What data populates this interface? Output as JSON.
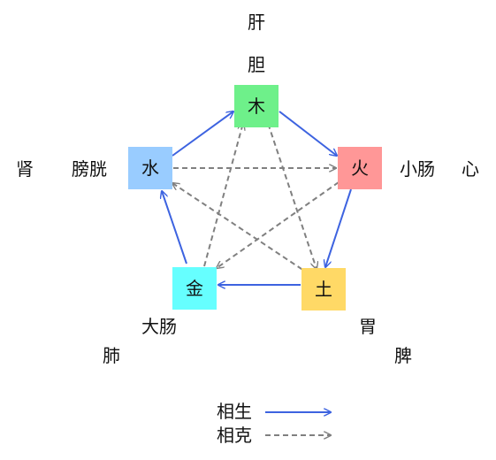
{
  "elements": {
    "wood": {
      "label": "木",
      "color": "#6ef08a",
      "fu_organ": "胆",
      "zang_organ": "肝"
    },
    "fire": {
      "label": "火",
      "color": "#ff9797",
      "fu_organ": "小肠",
      "zang_organ": "心"
    },
    "earth": {
      "label": "土",
      "color": "#ffd966",
      "fu_organ": "胃",
      "zang_organ": "脾"
    },
    "metal": {
      "label": "金",
      "color": "#66ffff",
      "fu_organ": "大肠",
      "zang_organ": "肺"
    },
    "water": {
      "label": "水",
      "color": "#99ccff",
      "fu_organ": "膀胱",
      "zang_organ": "肾"
    }
  },
  "relations": {
    "generating": [
      [
        "wood",
        "fire"
      ],
      [
        "fire",
        "earth"
      ],
      [
        "earth",
        "metal"
      ],
      [
        "metal",
        "water"
      ],
      [
        "water",
        "wood"
      ]
    ],
    "overcoming": [
      [
        "wood",
        "earth"
      ],
      [
        "earth",
        "water"
      ],
      [
        "water",
        "fire"
      ],
      [
        "fire",
        "metal"
      ],
      [
        "metal",
        "wood"
      ]
    ]
  },
  "colors": {
    "generating_arrow": "#3d63e0",
    "overcoming_arrow": "#808080"
  },
  "legend": {
    "generating_label": "相生",
    "overcoming_label": "相克"
  }
}
